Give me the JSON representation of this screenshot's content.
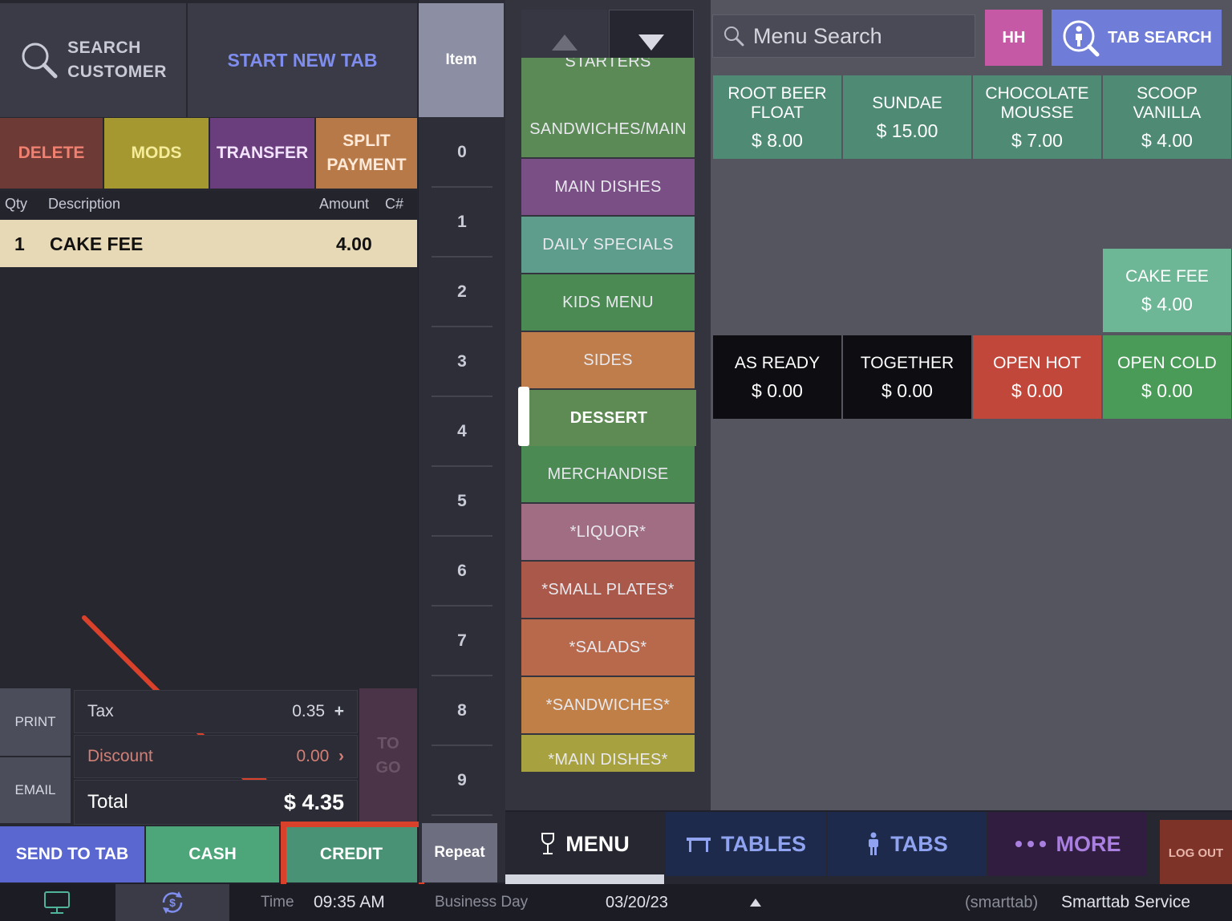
{
  "header": {
    "search_customer_line1": "SEARCH",
    "search_customer_line2": "CUSTOMER",
    "start_new_tab": "START NEW TAB",
    "item_tab": "Item"
  },
  "actions": {
    "delete": "DELETE",
    "mods": "MODS",
    "transfer": "TRANSFER",
    "split_line1": "SPLIT",
    "split_line2": "PAYMENT"
  },
  "order": {
    "columns": {
      "qty": "Qty",
      "description": "Description",
      "amount": "Amount",
      "check": "C#"
    },
    "items": [
      {
        "qty": "1",
        "description": "CAKE FEE",
        "amount": "4.00"
      }
    ]
  },
  "summary": {
    "print": "PRINT",
    "email": "EMAIL",
    "tax_label": "Tax",
    "tax_value": "0.35",
    "tax_symbol": "+",
    "discount_label": "Discount",
    "discount_value": "0.00",
    "discount_symbol": "›",
    "total_label": "Total",
    "total_value": "$ 4.35",
    "togo_line1": "TO",
    "togo_line2": "GO"
  },
  "payment": {
    "send_to_tab": "SEND TO TAB",
    "cash": "CASH",
    "credit": "CREDIT",
    "repeat": "Repeat"
  },
  "keypad": [
    "0",
    "1",
    "2",
    "3",
    "4",
    "5",
    "6",
    "7",
    "8",
    "9"
  ],
  "categories": [
    {
      "label": "STARTERS",
      "color": "#5b8a57"
    },
    {
      "label": "SANDWICHES/MAIN",
      "color": "#5b8a57"
    },
    {
      "label": "MAIN DISHES",
      "color": "#7a4f86"
    },
    {
      "label": "DAILY SPECIALS",
      "color": "#5e9c8c"
    },
    {
      "label": "KIDS MENU",
      "color": "#4b8a52"
    },
    {
      "label": "SIDES",
      "color": "#be7d4a"
    },
    {
      "label": "DESSERT",
      "color": "#5e8a54"
    },
    {
      "label": "MERCHANDISE",
      "color": "#4b8a52"
    },
    {
      "label": "*LIQUOR*",
      "color": "#a16d83"
    },
    {
      "label": "*SMALL PLATES*",
      "color": "#a9584a"
    },
    {
      "label": "*SALADS*",
      "color": "#b9694b"
    },
    {
      "label": "*SANDWICHES*",
      "color": "#c07f47"
    },
    {
      "label": "*MAIN DISHES*",
      "color": "#a8a140"
    }
  ],
  "menu_search": {
    "placeholder": "Menu Search",
    "hh": "HH",
    "tab_search": "TAB SEARCH"
  },
  "menu_items": [
    {
      "line1": "ROOT BEER",
      "line2": "FLOAT",
      "price": "$ 8.00",
      "color": "#4f8a75"
    },
    {
      "line1": "SUNDAE",
      "line2": "",
      "price": "$ 15.00",
      "color": "#4f8a75"
    },
    {
      "line1": "CHOCOLATE",
      "line2": "MOUSSE",
      "price": "$ 7.00",
      "color": "#4f8a75"
    },
    {
      "line1": "SCOOP",
      "line2": "VANILLA",
      "price": "$ 4.00",
      "color": "#4f8a75"
    },
    {
      "line1": "CAKE FEE",
      "line2": "",
      "price": "$ 4.00",
      "color": "#6db796"
    },
    {
      "line1": "AS READY",
      "line2": "",
      "price": "$ 0.00",
      "color": "#0d0d12"
    },
    {
      "line1": "TOGETHER",
      "line2": "",
      "price": "$ 0.00",
      "color": "#0d0d12"
    },
    {
      "line1": "OPEN HOT",
      "line2": "",
      "price": "$ 0.00",
      "color": "#c2473b"
    },
    {
      "line1": "OPEN COLD",
      "line2": "",
      "price": "$ 0.00",
      "color": "#4a9a58"
    }
  ],
  "nav": {
    "menu": "MENU",
    "tables": "TABLES",
    "tabs": "TABS",
    "more": "MORE",
    "logout": "LOG OUT"
  },
  "status": {
    "time_label": "Time",
    "time_value": "09:35 AM",
    "business_day_label": "Business Day",
    "business_day_value": "03/20/23",
    "account_tag": "(smarttab)",
    "account_name": "Smarttab Service"
  },
  "colors": {
    "annotation": "#d9412b",
    "accent": "#6f7cd8"
  }
}
